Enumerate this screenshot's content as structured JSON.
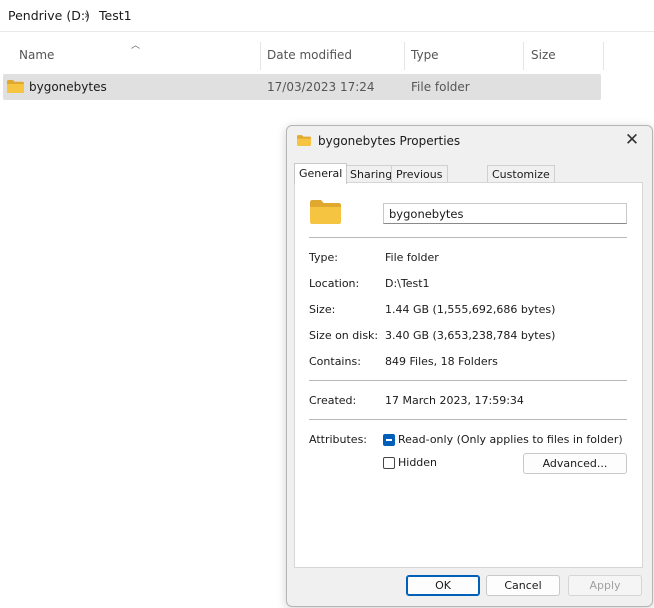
{
  "breadcrumb": {
    "items": [
      "Pendrive (D:)",
      "Test1"
    ],
    "separator": "›"
  },
  "columns": {
    "name": "Name",
    "date": "Date modified",
    "type": "Type",
    "size": "Size"
  },
  "files": [
    {
      "name": "bygonebytes",
      "date": "17/03/2023 17:24",
      "type": "File folder",
      "size": ""
    }
  ],
  "dialog": {
    "title": "bygonebytes Properties",
    "close_label": "✕",
    "tabs": [
      "General",
      "Sharing",
      "Previous Versions",
      "Customize"
    ],
    "name_value": "bygonebytes",
    "props": {
      "type_label": "Type:",
      "type_value": "File folder",
      "location_label": "Location:",
      "location_value": "D:\\Test1",
      "size_label": "Size:",
      "size_value": "1.44 GB (1,555,692,686 bytes)",
      "size_on_disk_label": "Size on disk:",
      "size_on_disk_value": "3.40 GB (3,653,238,784 bytes)",
      "contains_label": "Contains:",
      "contains_value": "849 Files, 18 Folders",
      "created_label": "Created:",
      "created_value": "17 March 2023, 17:59:34"
    },
    "attributes": {
      "label": "Attributes:",
      "readonly_label": "Read-only (Only applies to files in folder)",
      "hidden_label": "Hidden",
      "advanced_label": "Advanced..."
    },
    "buttons": {
      "ok": "OK",
      "cancel": "Cancel",
      "apply": "Apply"
    }
  },
  "colors": {
    "folder": "#f5c542",
    "folder_dark": "#e0a82e",
    "accent": "#005fb8"
  }
}
